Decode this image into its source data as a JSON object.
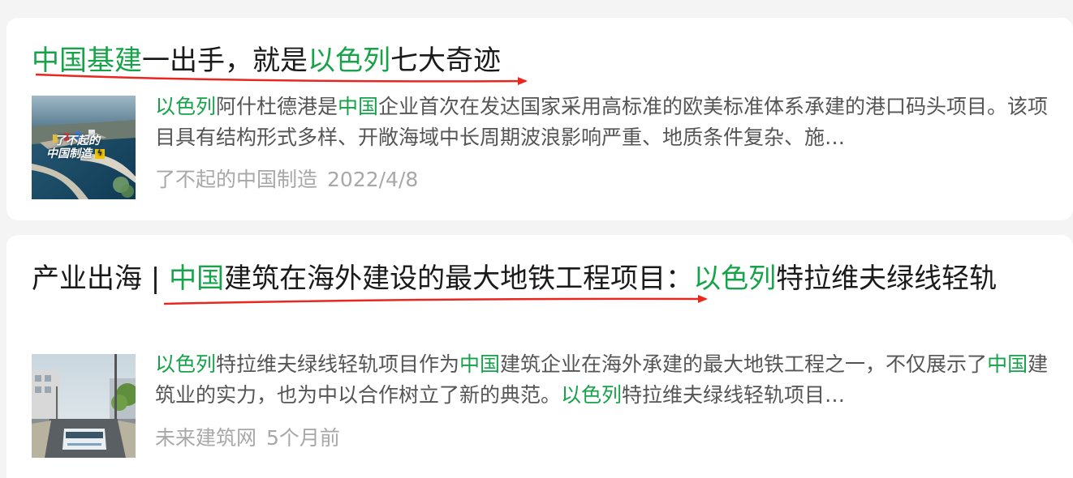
{
  "results": [
    {
      "title": [
        {
          "text": "中国基建",
          "hl": true
        },
        {
          "text": "一出手，就是",
          "hl": false
        },
        {
          "text": "以色列",
          "hl": true
        },
        {
          "text": "七大奇迹",
          "hl": false
        }
      ],
      "thumb_caption_1": "了不起的",
      "thumb_caption_2": "中国制造",
      "snippet": [
        {
          "text": "以色列",
          "hl": true
        },
        {
          "text": "阿什杜德港是",
          "hl": false
        },
        {
          "text": "中国",
          "hl": true
        },
        {
          "text": "企业首次在发达国家采用高标准的欧美标准体系承建的港口码头项目。该项目具有结构形式多样、开敞海域中长周期波浪影响严重、地质条件复杂、施…",
          "hl": false
        }
      ],
      "source": "了不起的中国制造",
      "date": "2022/4/8"
    },
    {
      "title": [
        {
          "text": "产业出海 | ",
          "hl": false
        },
        {
          "text": "中国",
          "hl": true
        },
        {
          "text": "建筑在海外建设的最大地铁工程项目：",
          "hl": false
        },
        {
          "text": "以色列",
          "hl": true
        },
        {
          "text": "特拉维夫绿线轻轨",
          "hl": false
        }
      ],
      "snippet": [
        {
          "text": "以色列",
          "hl": true
        },
        {
          "text": "特拉维夫绿线轻轨项目作为",
          "hl": false
        },
        {
          "text": "中国",
          "hl": true
        },
        {
          "text": "建筑企业在海外承建的最大地铁工程之一，不仅展示了",
          "hl": false
        },
        {
          "text": "中国",
          "hl": true
        },
        {
          "text": "建筑业的实力，也为中以合作树立了新的典范。",
          "hl": false
        },
        {
          "text": "以色列",
          "hl": true
        },
        {
          "text": "特拉维夫绿线轻轨项目…",
          "hl": false
        }
      ],
      "source": "未来建筑网",
      "date": "5个月前"
    }
  ],
  "colors": {
    "highlight": "#16a34a",
    "annotation_arrow": "#e8271f",
    "meta_text": "#a8a8a8",
    "snippet_text": "#555555",
    "title_text": "#1a1a1a"
  }
}
